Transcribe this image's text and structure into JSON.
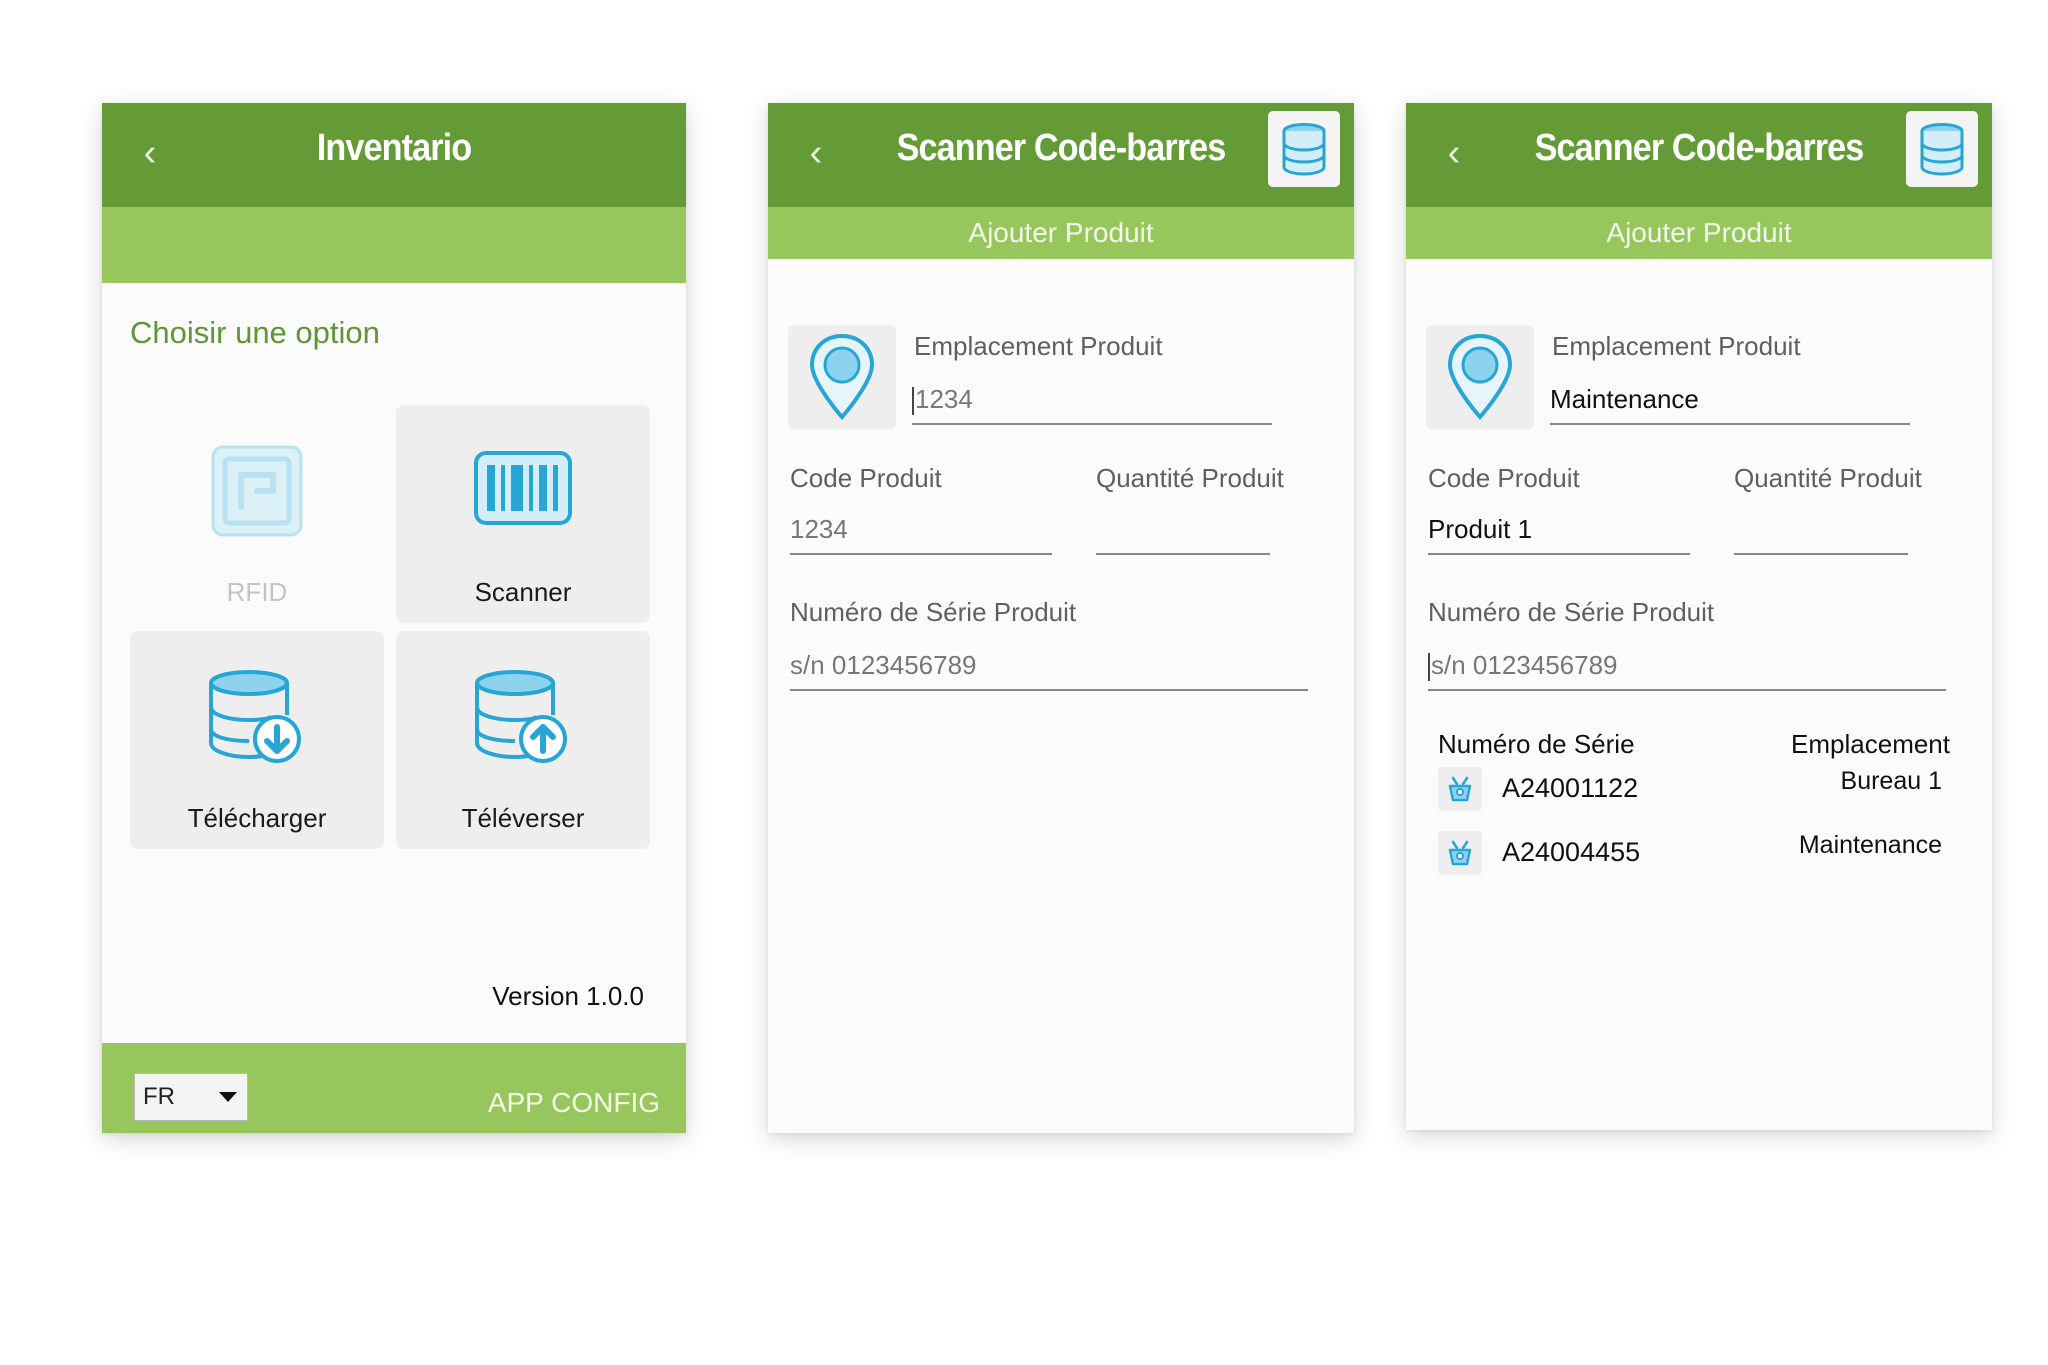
{
  "screens": [
    {
      "title": "Inventario",
      "prompt": "Choisir une option",
      "tiles": [
        {
          "label": "RFID",
          "icon": "rfid-icon",
          "enabled": false
        },
        {
          "label": "Scanner",
          "icon": "barcode-icon",
          "enabled": true
        },
        {
          "label": "Télécharger",
          "icon": "database-download-icon",
          "enabled": true
        },
        {
          "label": "Téléverser",
          "icon": "database-upload-icon",
          "enabled": true
        }
      ],
      "version": "Version 1.0.0",
      "language": "FR",
      "config_label": "APP CONFIG"
    },
    {
      "title": "Scanner Code-barres",
      "subtitle": "Ajouter Produit",
      "form": {
        "location_label": "Emplacement Produit",
        "location_value": "1234",
        "code_label": "Code Produit",
        "code_value": "1234",
        "quantity_label": "Quantité Produit",
        "quantity_value": "",
        "serial_label": "Numéro de Série Produit",
        "serial_placeholder": "s/n 0123456789"
      }
    },
    {
      "title": "Scanner Code-barres",
      "subtitle": "Ajouter Produit",
      "form": {
        "location_label": "Emplacement Produit",
        "location_value": "Maintenance",
        "code_label": "Code Produit",
        "code_value": "Produit 1",
        "quantity_label": "Quantité Produit",
        "quantity_value": "",
        "serial_label": "Numéro de Série Produit",
        "serial_placeholder": "s/n 0123456789"
      },
      "table": {
        "headers": [
          "Numéro de Série",
          "Emplacement"
        ],
        "rows": [
          {
            "serial": "A24001122",
            "location": "Bureau 1"
          },
          {
            "serial": "A24004455",
            "location": "Maintenance"
          }
        ]
      }
    }
  ],
  "colors": {
    "header_green": "#659b37",
    "light_green": "#97c65c",
    "icon_blue": "#27a5d4",
    "icon_fill": "#8ed3ee"
  }
}
